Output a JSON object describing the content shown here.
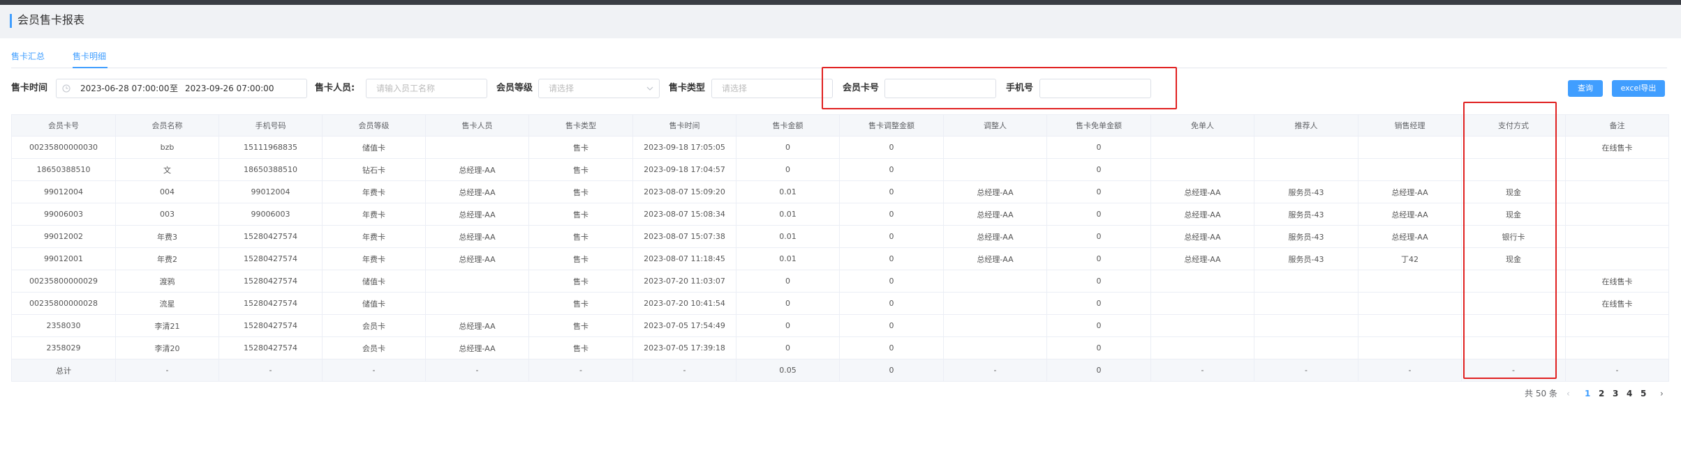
{
  "page": {
    "title": "会员售卡报表"
  },
  "tabs": [
    {
      "label": "售卡汇总"
    },
    {
      "label": "售卡明细"
    }
  ],
  "filters": {
    "sell_time_label": "售卡时间",
    "date_start": "2023-06-28 07:00:00",
    "date_sep": "至",
    "date_end": "2023-09-26 07:00:00",
    "seller_label": "售卡人员:",
    "seller_placeholder": "请输入员工名称",
    "level_label": "会员等级",
    "level_placeholder": "请选择",
    "type_label": "售卡类型",
    "type_placeholder": "请选择",
    "card_no_label": "会员卡号",
    "card_no_value": "",
    "phone_label": "手机号",
    "phone_value": ""
  },
  "buttons": {
    "query": "查询",
    "export": "excel导出"
  },
  "table": {
    "headers": [
      "会员卡号",
      "会员名称",
      "手机号码",
      "会员等级",
      "售卡人员",
      "售卡类型",
      "售卡时间",
      "售卡金额",
      "售卡调整金额",
      "调整人",
      "售卡免单金额",
      "免单人",
      "推荐人",
      "销售经理",
      "支付方式",
      "备注"
    ],
    "rows": [
      [
        "00235800000030",
        "bzb",
        "15111968835",
        "储值卡",
        "",
        "售卡",
        "2023-09-18 17:05:05",
        "0",
        "0",
        "",
        "0",
        "",
        "",
        "",
        "",
        "在线售卡"
      ],
      [
        "18650388510",
        "文",
        "18650388510",
        "钻石卡",
        "总经理-AA",
        "售卡",
        "2023-09-18 17:04:57",
        "0",
        "0",
        "",
        "0",
        "",
        "",
        "",
        "",
        ""
      ],
      [
        "99012004",
        "004",
        "99012004",
        "年费卡",
        "总经理-AA",
        "售卡",
        "2023-08-07 15:09:20",
        "0.01",
        "0",
        "总经理-AA",
        "0",
        "总经理-AA",
        "服务员-43",
        "总经理-AA",
        "现金",
        ""
      ],
      [
        "99006003",
        "003",
        "99006003",
        "年费卡",
        "总经理-AA",
        "售卡",
        "2023-08-07 15:08:34",
        "0.01",
        "0",
        "总经理-AA",
        "0",
        "总经理-AA",
        "服务员-43",
        "总经理-AA",
        "现金",
        ""
      ],
      [
        "99012002",
        "年费3",
        "15280427574",
        "年费卡",
        "总经理-AA",
        "售卡",
        "2023-08-07 15:07:38",
        "0.01",
        "0",
        "总经理-AA",
        "0",
        "总经理-AA",
        "服务员-43",
        "总经理-AA",
        "银行卡",
        ""
      ],
      [
        "99012001",
        "年费2",
        "15280427574",
        "年费卡",
        "总经理-AA",
        "售卡",
        "2023-08-07 11:18:45",
        "0.01",
        "0",
        "总经理-AA",
        "0",
        "总经理-AA",
        "服务员-43",
        "丁42",
        "现金",
        ""
      ],
      [
        "00235800000029",
        "渡鸦",
        "15280427574",
        "储值卡",
        "",
        "售卡",
        "2023-07-20 11:03:07",
        "0",
        "0",
        "",
        "0",
        "",
        "",
        "",
        "",
        "在线售卡"
      ],
      [
        "00235800000028",
        "流星",
        "15280427574",
        "储值卡",
        "",
        "售卡",
        "2023-07-20 10:41:54",
        "0",
        "0",
        "",
        "0",
        "",
        "",
        "",
        "",
        "在线售卡"
      ],
      [
        "2358030",
        "李清21",
        "15280427574",
        "会员卡",
        "总经理-AA",
        "售卡",
        "2023-07-05 17:54:49",
        "0",
        "0",
        "",
        "0",
        "",
        "",
        "",
        "",
        ""
      ],
      [
        "2358029",
        "李清20",
        "15280427574",
        "会员卡",
        "总经理-AA",
        "售卡",
        "2023-07-05 17:39:18",
        "0",
        "0",
        "",
        "0",
        "",
        "",
        "",
        "",
        ""
      ]
    ],
    "total_row": [
      "总计",
      "-",
      "-",
      "-",
      "-",
      "-",
      "-",
      "0.05",
      "0",
      "-",
      "0",
      "-",
      "-",
      "-",
      "-",
      "-"
    ]
  },
  "pagination": {
    "total_text": "共 50 条",
    "prev_icon": "‹",
    "pages": [
      "1",
      "2",
      "3",
      "4",
      "5"
    ],
    "current": "1",
    "next_icon": "›"
  },
  "colors": {
    "accent": "#409eff",
    "highlight": "#e02020",
    "header_bg": "#f0f2f5"
  }
}
